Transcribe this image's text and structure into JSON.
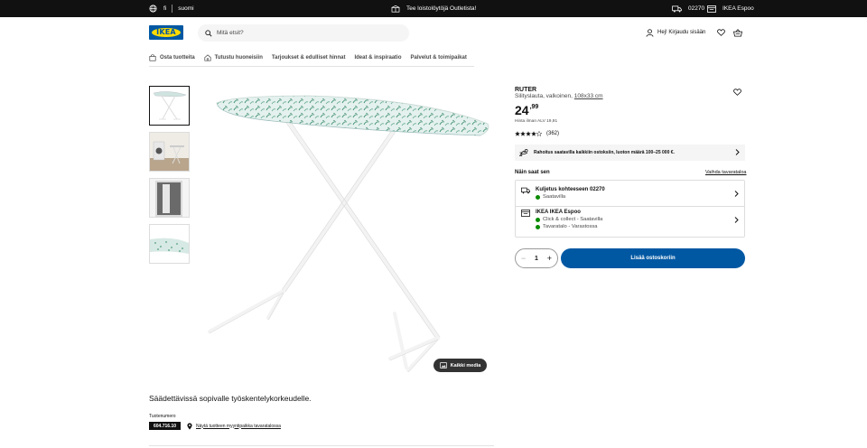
{
  "topbar": {
    "lang_code": "fi",
    "lang_name": "suomi",
    "promo": "Tee loistolöytöjä Outletista!",
    "postcode": "02270",
    "store": "IKEA Espoo"
  },
  "header": {
    "logo_text": "IKEA",
    "search_placeholder": "Mitä etsit?",
    "login_label": "Hej! Kirjaudu sisään",
    "brand_blue": "#0058a3",
    "brand_yellow": "#ffdb00"
  },
  "nav": {
    "items": [
      {
        "label": "Osta tuotteita",
        "icon": "shopping-bag-icon"
      },
      {
        "label": "Tutustu huoneisiin",
        "icon": "house-icon"
      },
      {
        "label": "Tarjoukset & edulliset hinnat"
      },
      {
        "label": "Ideat & inspiraatio"
      },
      {
        "label": "Palvelut & toimipaikat"
      }
    ]
  },
  "gallery": {
    "media_button": "Kaikki media"
  },
  "product": {
    "name": "RUTER",
    "desc_prefix": "Silityslauta, valkoinen, ",
    "desc_size": "108x33 cm",
    "price_main": "24",
    "price_decimal": ",99",
    "vat_text": "Hinta ilman ALV 19,91",
    "rating": 4,
    "rating_max": 5,
    "review_count": "(362)",
    "description": "Säädettävissä sopivalle työskentelykorkeudelle.",
    "article_label": "Tuotenumero",
    "article_number": "604.716.10",
    "store_link": "Näytä tuotteen myyntipaikka tavaratalossa"
  },
  "finance": {
    "text": "Rahoitus saatavilla kaikkiin ostoksiin, luoton määrä 100–25 000 €."
  },
  "delivery": {
    "heading": "Näin saat sen",
    "change_store": "Vaihda tavarataloa",
    "ship_title": "Kuljetus kohteeseen 02270",
    "ship_status": "Saatavilla",
    "store_title": "IKEA IKEA Espoo",
    "store_click": "Click & collect - Saatavilla",
    "store_stock": "Tavaratalo - Varastossa",
    "status_color": "#0a8a00"
  },
  "cart": {
    "qty_minus": "−",
    "qty_value": "1",
    "qty_plus": "+",
    "add_label": "Lisää ostoskoriin"
  }
}
